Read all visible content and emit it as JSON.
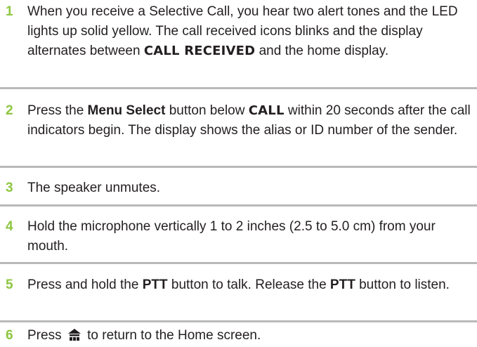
{
  "steps": [
    {
      "number": "1",
      "text_a": "When you receive a Selective Call, you hear two alert tones and the LED lights up solid yellow. The call received icons blinks and the display alternates between ",
      "display_text": "CALL RECEIVED",
      "text_b": " and the home display."
    },
    {
      "number": "2",
      "text_a": "Press the ",
      "button_name": "Menu Select",
      "text_b": " button below ",
      "display_text": "CALL",
      "text_c": " within 20 seconds after the call indicators begin. The display shows the alias or ID number of the sender."
    },
    {
      "number": "3",
      "text": "The speaker unmutes."
    },
    {
      "number": "4",
      "text": "Hold the microphone vertically 1 to 2 inches (2.5 to 5.0 cm) from your mouth."
    },
    {
      "number": "5",
      "text_a": "Press and hold the ",
      "button_name": "PTT",
      "text_b": " button to talk. Release the ",
      "button_name_2": "PTT",
      "text_c": " button to listen."
    },
    {
      "number": "6",
      "text_a": "Press ",
      "icon": "home-icon",
      "text_b": " to return to the Home screen."
    }
  ],
  "colors": {
    "step_number": "#8dc63f",
    "divider": "#b9b9b9",
    "text": "#231f20"
  }
}
